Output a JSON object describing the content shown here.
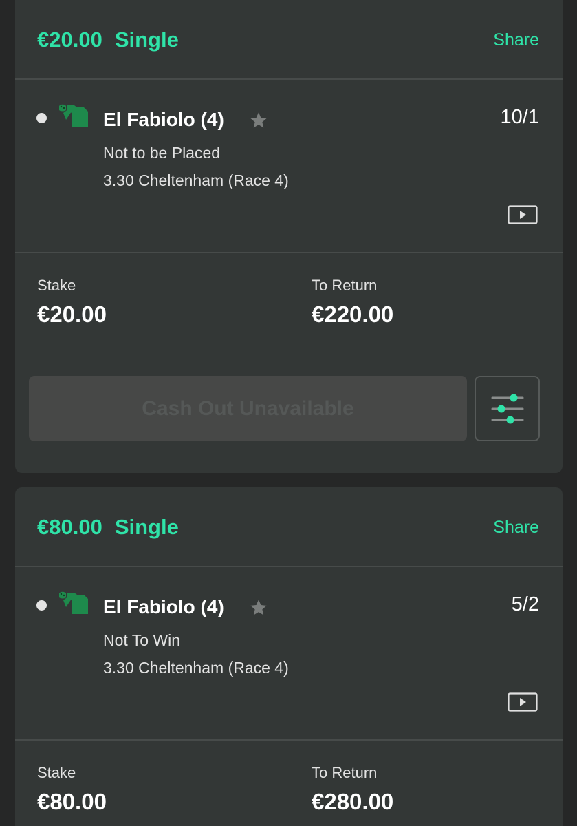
{
  "bets": [
    {
      "amount": "€20.00",
      "type": "Single",
      "share_label": "Share",
      "selection": {
        "horse": "El Fabiolo (4)",
        "odds": "10/1",
        "market": "Not to be Placed",
        "event": "3.30 Cheltenham (Race 4)"
      },
      "stake_label": "Stake",
      "stake_value": "€20.00",
      "return_label": "To Return",
      "return_value": "€220.00",
      "cashout_label": "Cash Out Unavailable"
    },
    {
      "amount": "€80.00",
      "type": "Single",
      "share_label": "Share",
      "selection": {
        "horse": "El Fabiolo (4)",
        "odds": "5/2",
        "market": "Not To Win",
        "event": "3.30 Cheltenham (Race 4)"
      },
      "stake_label": "Stake",
      "stake_value": "€80.00",
      "return_label": "To Return",
      "return_value": "€280.00"
    }
  ],
  "icons": {
    "silks": "jockey-silks-icon",
    "star": "star-icon",
    "video": "play-video-icon",
    "settings": "sliders-icon"
  },
  "colors": {
    "accent": "#2fe3a8",
    "card_bg": "#333736",
    "page_bg": "#262727",
    "silks_green": "#1e8a4c",
    "cashout_disabled_bg": "#474847"
  }
}
